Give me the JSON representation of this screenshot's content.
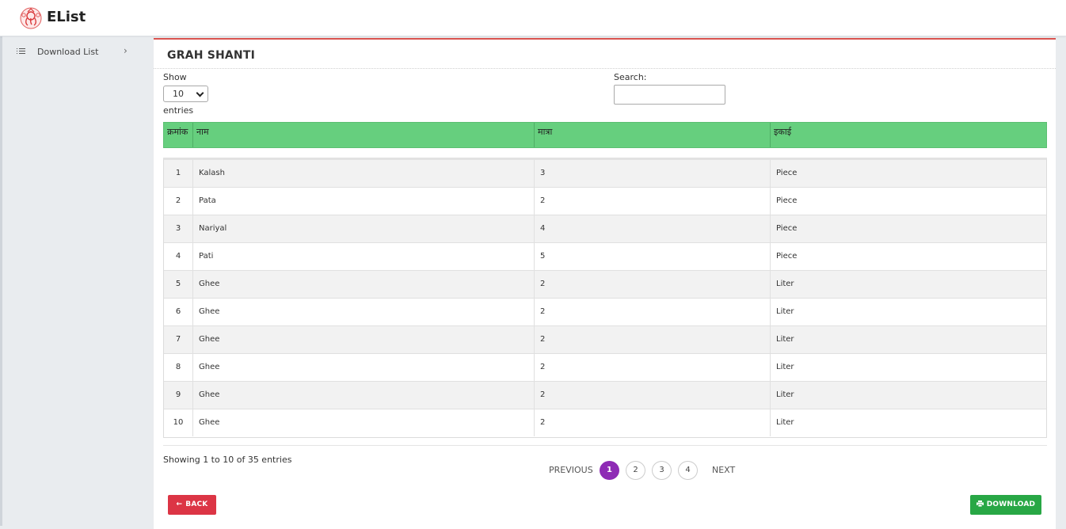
{
  "app": {
    "brand": "EList"
  },
  "sidebar": {
    "items": [
      {
        "label": "Download List"
      }
    ]
  },
  "card": {
    "title": "GRAH SHANTI"
  },
  "controls": {
    "show_label": "Show",
    "entries_value": "10",
    "entries_label": "entries",
    "search_label": "Search:",
    "search_value": ""
  },
  "table": {
    "headers": [
      "क्रमांक",
      "नाम",
      "मात्रा",
      "इकाई"
    ],
    "rows": [
      [
        "1",
        "Kalash",
        "3",
        "Piece"
      ],
      [
        "2",
        "Pata",
        "2",
        "Piece"
      ],
      [
        "3",
        "Nariyal",
        "4",
        "Piece"
      ],
      [
        "4",
        "Pati",
        "5",
        "Piece"
      ],
      [
        "5",
        "Ghee",
        "2",
        "Liter"
      ],
      [
        "6",
        "Ghee",
        "2",
        "Liter"
      ],
      [
        "7",
        "Ghee",
        "2",
        "Liter"
      ],
      [
        "8",
        "Ghee",
        "2",
        "Liter"
      ],
      [
        "9",
        "Ghee",
        "2",
        "Liter"
      ],
      [
        "10",
        "Ghee",
        "2",
        "Liter"
      ]
    ]
  },
  "footer": {
    "showing": "Showing 1 to 10 of 35 entries",
    "previous": "PREVIOUS",
    "next": "NEXT",
    "pages": [
      "1",
      "2",
      "3",
      "4"
    ],
    "current_page": "1"
  },
  "buttons": {
    "back": "BACK",
    "download": "DOWNLOAD"
  },
  "colors": {
    "header_green": "#66cf7e",
    "accent_red": "#d9534f",
    "back_red": "#dc3545",
    "download_green": "#28a745",
    "active_page_purple": "#8e2bb5"
  },
  "icons": {
    "logo": "ganesha-logo-icon",
    "sidebar_item": "list-icon",
    "sidebar_chevron": "chevron-right-icon",
    "back": "arrow-left-icon",
    "download": "print-icon",
    "select_caret": "chevron-down-icon"
  }
}
